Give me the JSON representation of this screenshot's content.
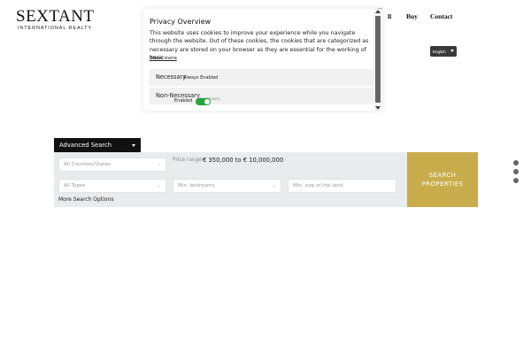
{
  "header": {
    "logo_main": "SEXTANT",
    "logo_sub": "INTERNATIONAL REALTY",
    "nav_partial": "ll",
    "nav_buy": "Buy",
    "nav_contact": "Contact",
    "language": "English"
  },
  "privacy_modal": {
    "close": "×",
    "title": "Privacy Overview",
    "body": "This website uses cookies to improve your experience while you navigate through the website. Out of these cookies, the cookies that are categorized as necessary are stored on your browser as they are essential for the working of basic...",
    "show_more": "Show more",
    "categories": [
      {
        "title": "Necessary",
        "status": "Always Enabled"
      },
      {
        "title": "Non-Necessary",
        "status": "Necessary",
        "toggle_label": "Enabled",
        "enabled": true
      }
    ]
  },
  "search": {
    "tab_label": "Advanced Search",
    "counties_placeholder": "All Counties/States",
    "price_label": "Price range:",
    "price_range": "€ 350,000 to € 10,000,000",
    "types_placeholder": "All Types",
    "bedrooms_placeholder": "Min. bedrooms",
    "land_placeholder": "Min. size of the land",
    "more_options": "More Search Options",
    "submit_label": "SEARCH PROPERTIES"
  },
  "colors": {
    "accent_gold": "#c9ac4c",
    "toggle_green": "#27a33b",
    "panel_bg": "#e9ecec"
  },
  "slider": {
    "dots": 3
  }
}
